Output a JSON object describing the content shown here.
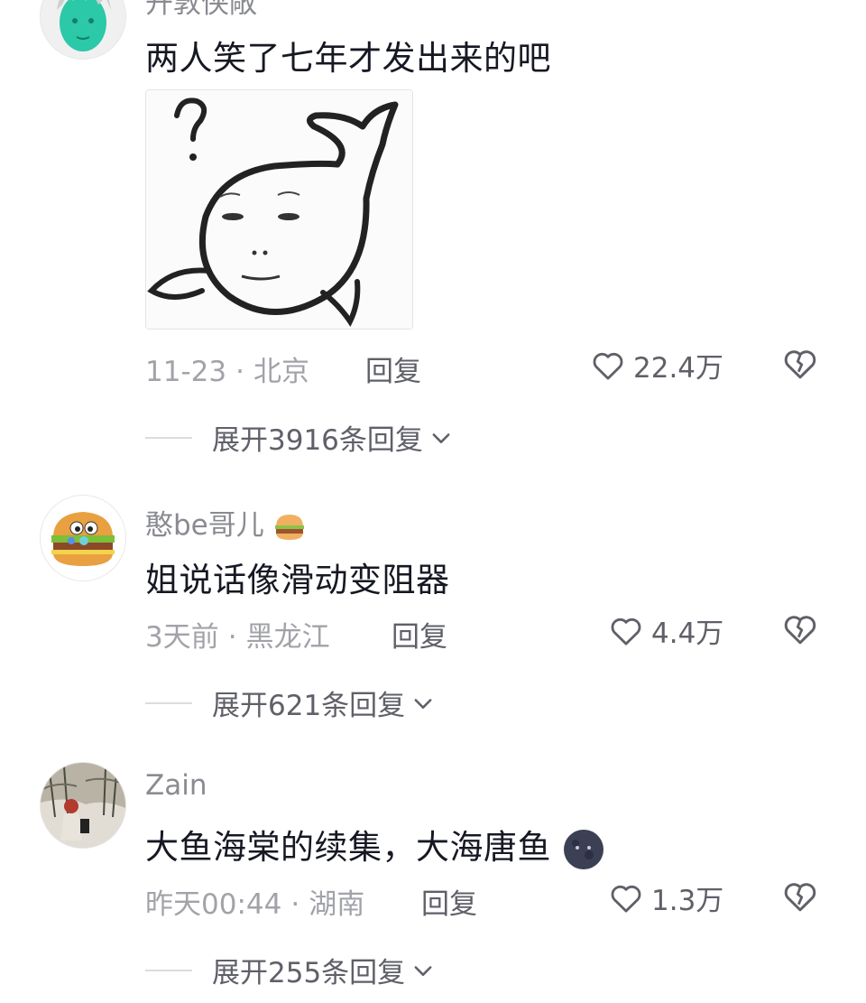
{
  "comments": [
    {
      "username": "开敦侠敞",
      "text": "两人笑了七年才发出来的吧",
      "date": "11-23",
      "location": "北京",
      "reply_label": "回复",
      "likes": "22.4万",
      "expand_label": "展开3916条回复"
    },
    {
      "username": "憨be哥儿",
      "text": "姐说话像滑动变阻器",
      "date": "3天前",
      "location": "黑龙江",
      "reply_label": "回复",
      "likes": "4.4万",
      "expand_label": "展开621条回复"
    },
    {
      "username": "Zain",
      "text": "大鱼海棠的续集，大海唐鱼",
      "date": "昨天00:44",
      "location": "湖南",
      "reply_label": "回复",
      "likes": "1.3万",
      "expand_label": "展开255条回复"
    }
  ],
  "icons": {
    "like": "heart-outline-icon",
    "dislike": "broken-heart-icon",
    "expand": "chevron-down-icon"
  },
  "colors": {
    "text": "#161823",
    "meta": "#a2a3a8",
    "secondary": "#5f6068"
  }
}
